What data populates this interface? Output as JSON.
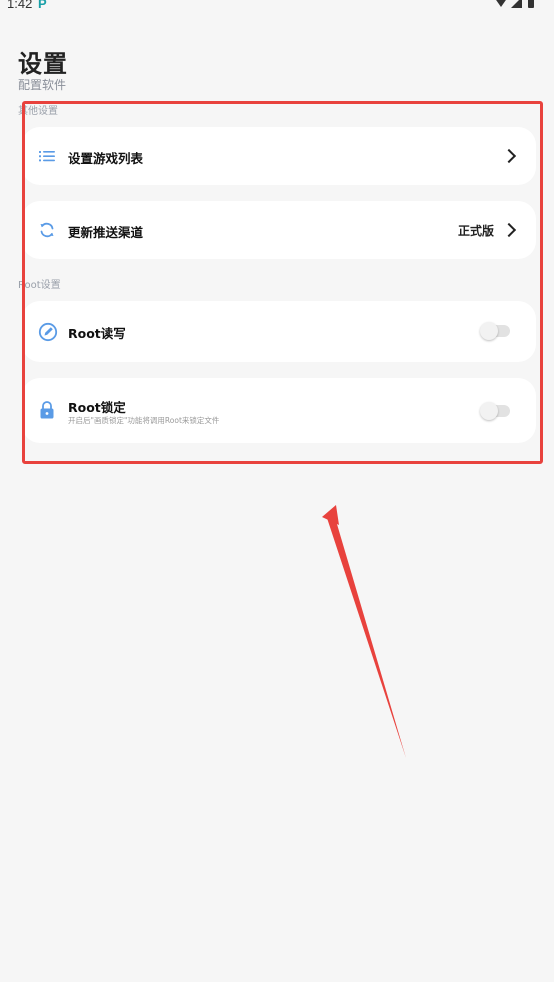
{
  "status_bar": {
    "time": "1:42",
    "app_icon_glyph": "P"
  },
  "header": {
    "title": "设置",
    "subtitle": "配置软件"
  },
  "sections": {
    "other": {
      "label": "其他设置"
    },
    "root": {
      "label": "Root设置"
    }
  },
  "items": {
    "game_list": {
      "title": "设置游戏列表",
      "icon": "list-icon"
    },
    "update_channel": {
      "title": "更新推送渠道",
      "value": "正式版",
      "icon": "sync-icon"
    },
    "root_rw": {
      "title": "Root读写",
      "icon": "edit-icon",
      "enabled": false
    },
    "root_lock": {
      "title": "Root锁定",
      "description": "开启后\"画质锁定\"功能将调用Root来锁定文件",
      "icon": "lock-icon",
      "enabled": false
    }
  },
  "colors": {
    "accent_icon": "#5a9be6",
    "annotation_red": "#e8423d",
    "background": "#f6f6f6"
  }
}
